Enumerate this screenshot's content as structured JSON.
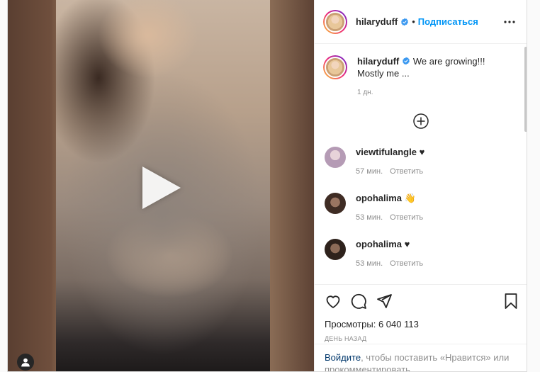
{
  "header": {
    "username": "hilaryduff",
    "follow_label": "Подписаться"
  },
  "caption": {
    "username": "hilaryduff",
    "text_line1": "We are growing!!!",
    "text_line2": "Mostly me ...",
    "time": "1 дн."
  },
  "comments": [
    {
      "username": "viewtifulangle",
      "text": "♥",
      "time": "57 мин.",
      "reply": "Ответить",
      "avatar_color": "#c9b8c9"
    },
    {
      "username": "opohalima",
      "text": "👋",
      "time": "53 мин.",
      "reply": "Ответить",
      "avatar_color": "#6b4a3a"
    },
    {
      "username": "opohalima",
      "text": "♥",
      "time": "53 мин.",
      "reply": "Ответить",
      "avatar_color": "#5b3d2f"
    }
  ],
  "actions": {
    "views_label": "Просмотры:",
    "views_count": "6 040 113",
    "date": "ДЕНЬ НАЗАД"
  },
  "login": {
    "link": "Войдите",
    "text": ", чтобы поставить «Нравится» или прокомментировать."
  },
  "icons": [
    "play-icon",
    "user-icon",
    "verified-icon",
    "more-icon",
    "add-comments-icon",
    "heart-icon",
    "comment-icon",
    "share-icon",
    "save-icon"
  ],
  "colors": {
    "accent": "#0095f6",
    "link": "#00376b",
    "muted": "#8e8e8e"
  }
}
